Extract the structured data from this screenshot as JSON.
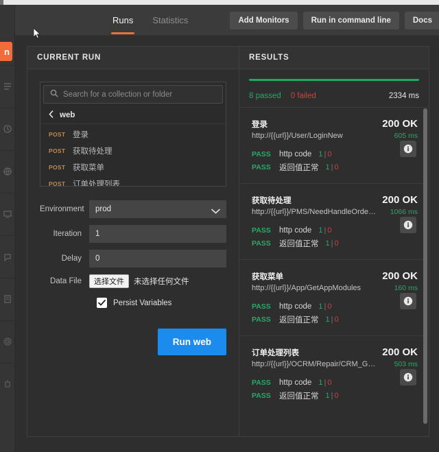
{
  "header": {
    "tabs": [
      {
        "label": "Runs",
        "active": true
      },
      {
        "label": "Statistics",
        "active": false
      }
    ],
    "buttons": [
      {
        "label": "Add Monitors",
        "name": "add-monitors-button"
      },
      {
        "label": "Run in command line",
        "name": "run-in-command-line-button"
      },
      {
        "label": "Docs",
        "name": "docs-button"
      }
    ],
    "accent_color": "#e8713c"
  },
  "rail": {
    "badge_text": "n",
    "badge_color": "#f26b3a"
  },
  "left_panel": {
    "title": "CURRENT RUN",
    "search": {
      "placeholder": "Search for a collection or folder",
      "value": "",
      "icon": "search-icon"
    },
    "breadcrumb": {
      "back_icon": "chevron-left-icon",
      "label": "web"
    },
    "requests": [
      {
        "method": "POST",
        "name": "登录"
      },
      {
        "method": "POST",
        "name": "获取待处理"
      },
      {
        "method": "POST",
        "name": "获取菜单"
      },
      {
        "method": "POST",
        "name": "订单处理列表"
      }
    ],
    "form": {
      "environment_label": "Environment",
      "environment_value": "prod",
      "environment_options": [
        "prod"
      ],
      "iteration_label": "Iteration",
      "iteration_value": "1",
      "delay_label": "Delay",
      "delay_value": "0",
      "data_file_label": "Data File",
      "data_file_button": "选择文件",
      "data_file_status": "未选择任何文件",
      "persist_label": "Persist Variables",
      "persist_checked": true,
      "run_button": "Run web",
      "run_button_color": "#1b8ced"
    }
  },
  "right_panel": {
    "title": "RESULTS",
    "summary": {
      "progress_percent": 100,
      "passed": "8 passed",
      "failed": "0 failed",
      "total_time": "2334 ms",
      "pass_color": "#2aa868",
      "fail_color": "#d0403f"
    },
    "results": [
      {
        "name": "登录",
        "url": "http://{{url}}/User/LoginNew",
        "status": "200 OK",
        "time": "605 ms",
        "info_icon": "info-icon",
        "assertions": [
          {
            "result": "PASS",
            "name": "http code",
            "ok": "1",
            "bad": "0"
          },
          {
            "result": "PASS",
            "name": "返回值正常",
            "ok": "1",
            "bad": "0"
          }
        ]
      },
      {
        "name": "获取待处理",
        "url": "http://{{url}}/PMS/NeedHandleOrder/...",
        "status": "200 OK",
        "time": "1066 ms",
        "info_icon": "info-icon",
        "assertions": [
          {
            "result": "PASS",
            "name": "http code",
            "ok": "1",
            "bad": "0"
          },
          {
            "result": "PASS",
            "name": "返回值正常",
            "ok": "1",
            "bad": "0"
          }
        ]
      },
      {
        "name": "获取菜单",
        "url": "http://{{url}}/App/GetAppModules",
        "status": "200 OK",
        "time": "160 ms",
        "info_icon": "info-icon",
        "assertions": [
          {
            "result": "PASS",
            "name": "http code",
            "ok": "1",
            "bad": "0"
          },
          {
            "result": "PASS",
            "name": "返回值正常",
            "ok": "1",
            "bad": "0"
          }
        ]
      },
      {
        "name": "订单处理列表",
        "url": "http://{{url}}/OCRM/Repair/CRM_Get...",
        "status": "200 OK",
        "time": "503 ms",
        "info_icon": "info-icon",
        "assertions": [
          {
            "result": "PASS",
            "name": "http code",
            "ok": "1",
            "bad": "0"
          },
          {
            "result": "PASS",
            "name": "返回值正常",
            "ok": "1",
            "bad": "0"
          }
        ]
      }
    ]
  }
}
